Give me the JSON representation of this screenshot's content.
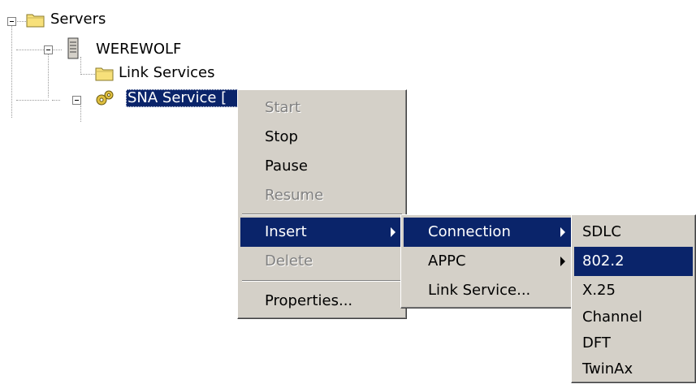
{
  "tree": {
    "root_label": "Servers",
    "server_label": "WEREWOLF",
    "link_services_label": "Link Services",
    "sna_service_label": "SNA Service  ["
  },
  "context_menu": {
    "items": [
      {
        "label": "Start",
        "state": "disabled"
      },
      {
        "label": "Stop",
        "state": "enabled"
      },
      {
        "label": "Pause",
        "state": "enabled"
      },
      {
        "label": "Resume",
        "state": "disabled"
      },
      {
        "label": "Insert",
        "state": "highlighted",
        "submenu": true
      },
      {
        "label": "Delete",
        "state": "disabled"
      },
      {
        "label": "Properties...",
        "state": "enabled"
      }
    ]
  },
  "insert_submenu": {
    "items": [
      {
        "label": "Connection",
        "state": "highlighted",
        "submenu": true
      },
      {
        "label": "APPC",
        "state": "enabled",
        "submenu": true
      },
      {
        "label": "Link Service...",
        "state": "enabled"
      }
    ]
  },
  "connection_submenu": {
    "items": [
      {
        "label": "SDLC",
        "state": "enabled"
      },
      {
        "label": "802.2",
        "state": "highlighted"
      },
      {
        "label": "X.25",
        "state": "enabled"
      },
      {
        "label": "Channel",
        "state": "enabled"
      },
      {
        "label": "DFT",
        "state": "enabled"
      },
      {
        "label": "TwinAx",
        "state": "enabled"
      }
    ]
  },
  "colors": {
    "selection": "#0a246a",
    "menu_face": "#d4d0c8",
    "disabled_text": "#808080"
  }
}
